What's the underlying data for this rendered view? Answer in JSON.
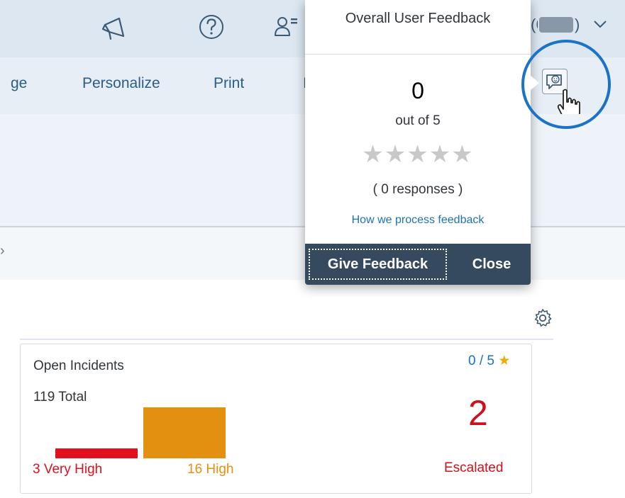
{
  "shell": {
    "user_name_fragment": "(6",
    "user_paren": ")"
  },
  "toolbar": {
    "items": [
      "ge",
      "Personalize",
      "Print",
      "I"
    ]
  },
  "popover": {
    "title": "Overall User Feedback",
    "rating_value": "0",
    "rating_scale": "out of 5",
    "stars": "★★★★★",
    "responses": "( 0 responses )",
    "process_link": "How we process feedback",
    "give_feedback": "Give Feedback",
    "close": "Close"
  },
  "subbar": {
    "fragment": "›"
  },
  "card": {
    "title": "Open Incidents",
    "rating_badge": "0 / 5",
    "rating_star": "★",
    "total": "119 Total",
    "escalated_count": "2",
    "escalated_label": "Escalated",
    "bars": [
      {
        "label": "3 Very High",
        "value": 3,
        "color": "#e0111e"
      },
      {
        "label": "16 High",
        "value": 16,
        "color": "#e39010"
      }
    ]
  },
  "colors": {
    "very_high": "#e0111e",
    "high": "#e39010",
    "escalated": "#d0101e",
    "link": "#1b72b8",
    "annotation_circle": "#1a73c7"
  }
}
